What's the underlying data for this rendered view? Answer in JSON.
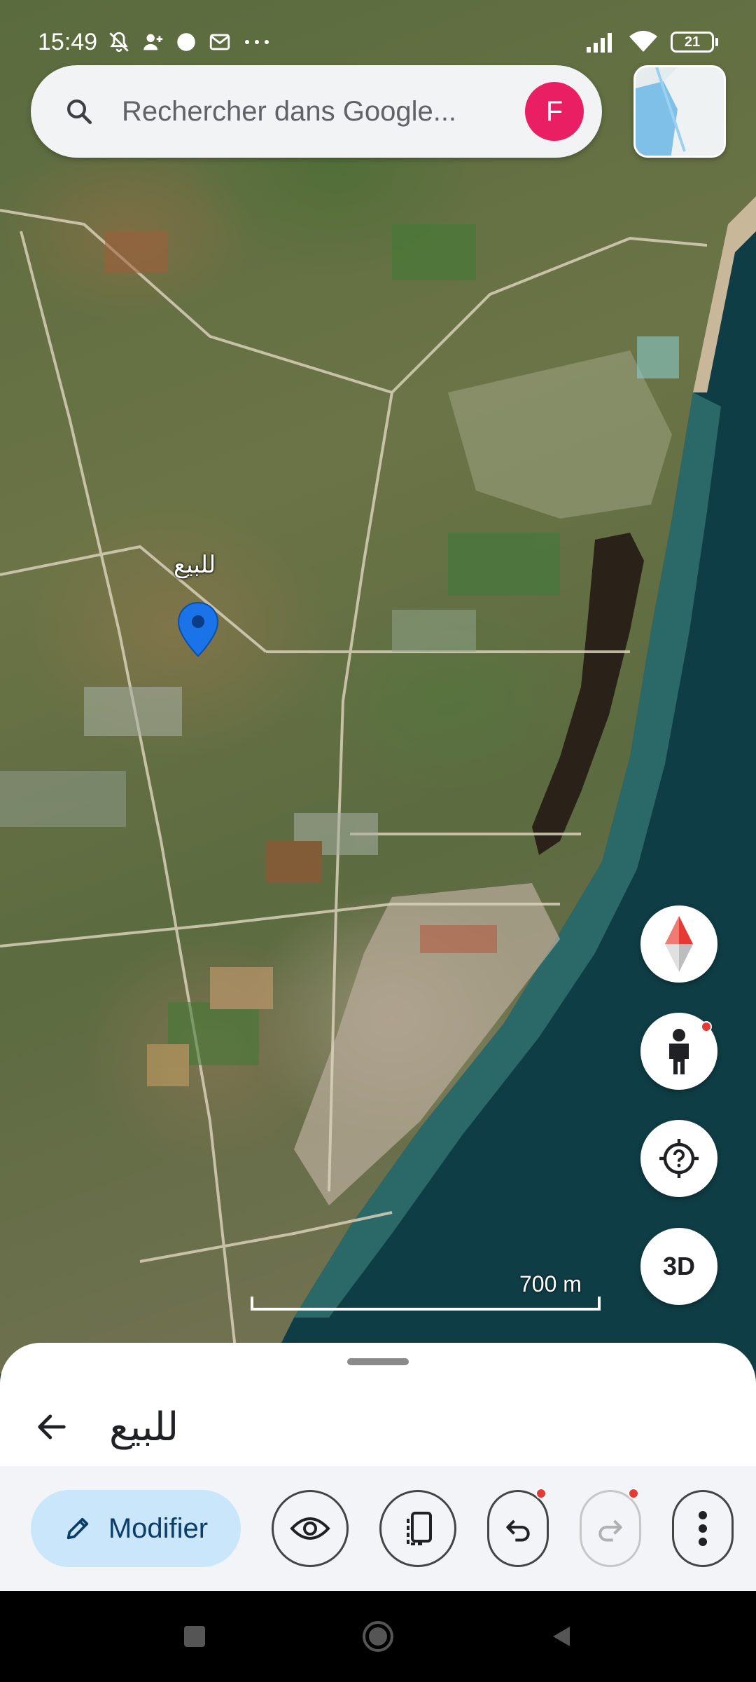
{
  "status_bar": {
    "time": "15:49",
    "icons": [
      "mute-icon",
      "person-add-icon",
      "chat-icon",
      "mail-icon",
      "more-icon"
    ],
    "battery": "21"
  },
  "search": {
    "placeholder": "Rechercher dans Google...",
    "avatar_letter": "F"
  },
  "map": {
    "marker_label": "للبيع",
    "scale_label": "700 m",
    "controls": [
      "compass-icon",
      "pegman-icon",
      "help-icon",
      "3D"
    ]
  },
  "sheet": {
    "title": "للبيع",
    "edit_label": "Modifier"
  },
  "colors": {
    "avatar": "#e91e63",
    "edit_button": "#c9e6fb",
    "pin": "#1a73e8",
    "notification_dot": "#e53935"
  }
}
